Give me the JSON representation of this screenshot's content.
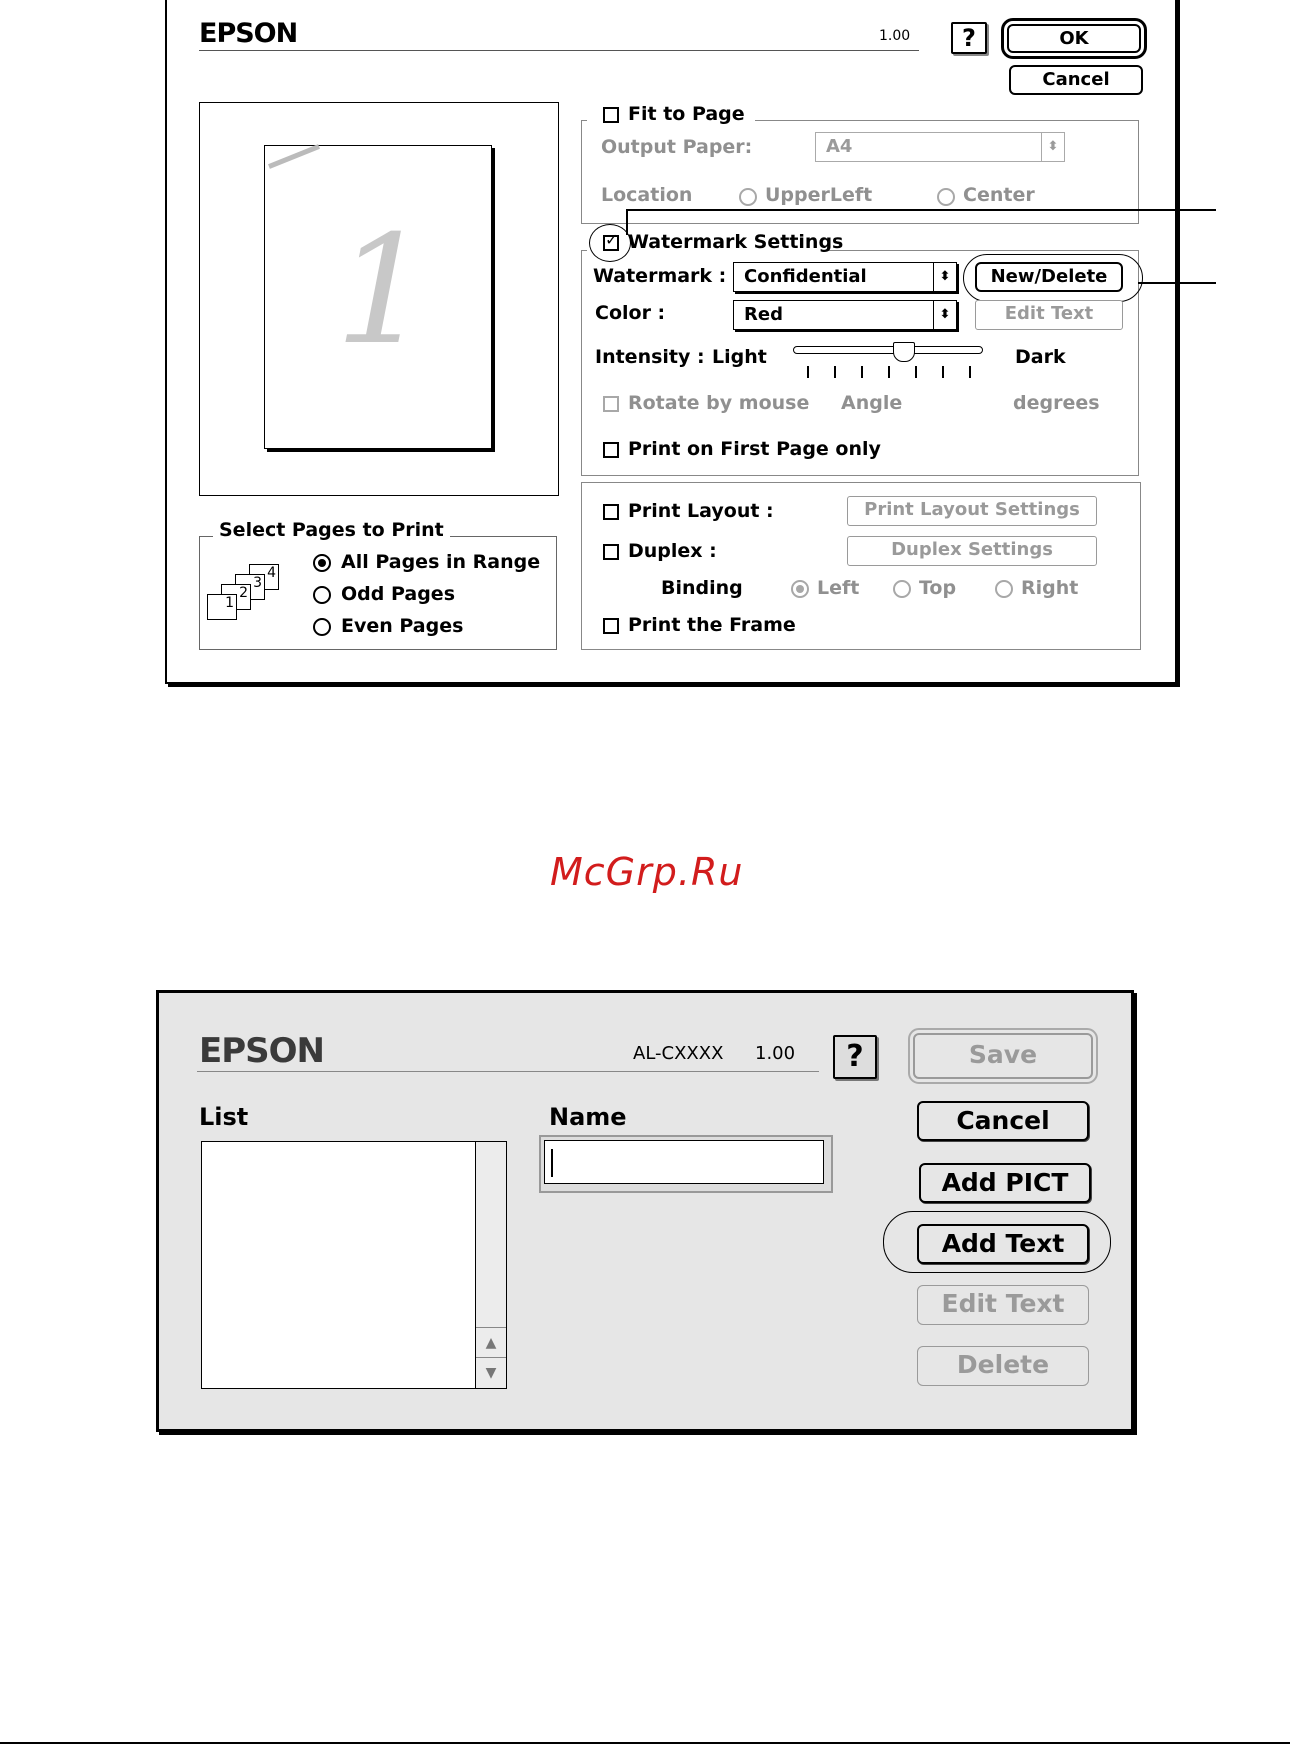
{
  "dialog1": {
    "brand": "EPSON",
    "version": "1.00",
    "help_label": "?",
    "ok_label": "OK",
    "cancel_label": "Cancel",
    "preview_page_number": "1",
    "fit_to_page": {
      "label": "Fit to Page",
      "output_paper_label": "Output Paper:",
      "output_paper_value": "A4",
      "location_label": "Location",
      "location_options": [
        "UpperLeft",
        "Center"
      ]
    },
    "watermark": {
      "section_label": "Watermark Settings",
      "watermark_label": "Watermark :",
      "watermark_value": "Confidential",
      "new_delete_label": "New/Delete",
      "color_label": "Color :",
      "color_value": "Red",
      "edit_text_label": "Edit Text",
      "intensity_label": "Intensity :",
      "intensity_light": "Light",
      "intensity_dark": "Dark",
      "intensity_level": 0.6,
      "rotate_label": "Rotate by mouse",
      "angle_label": "Angle",
      "degrees_label": "degrees",
      "first_page_label": "Print on First Page only"
    },
    "select_pages": {
      "title": "Select Pages to Print",
      "options": [
        "All Pages in Range",
        "Odd Pages",
        "Even Pages"
      ],
      "icon_numbers": [
        "1",
        "2",
        "3",
        "4"
      ]
    },
    "layout": {
      "print_layout_label": "Print Layout :",
      "print_layout_settings": "Print Layout Settings",
      "duplex_label": "Duplex :",
      "duplex_settings": "Duplex Settings",
      "binding_label": "Binding",
      "binding_options": [
        "Left",
        "Top",
        "Right"
      ],
      "frame_label": "Print the Frame"
    }
  },
  "watermark_text": "McGrp.Ru",
  "dialog2": {
    "brand": "EPSON",
    "model": "AL-CXXXX",
    "version": "1.00",
    "help_label": "?",
    "list_label": "List",
    "name_label": "Name",
    "name_value": "",
    "save_label": "Save",
    "cancel_label": "Cancel",
    "add_pict_label": "Add PICT",
    "add_text_label": "Add Text",
    "edit_text_label": "Edit Text",
    "delete_label": "Delete"
  }
}
